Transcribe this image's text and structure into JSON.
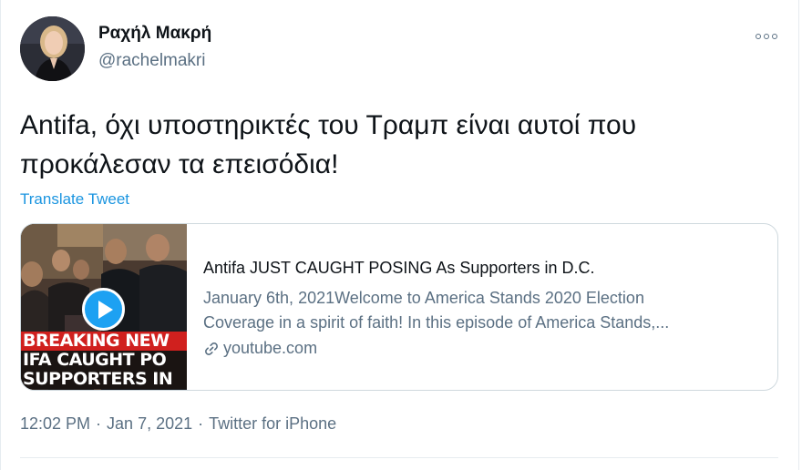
{
  "author": {
    "display_name": "Ραχήλ Μακρή",
    "handle": "@rachelmakri"
  },
  "tweet": {
    "text": "Antifa, όχι υποστηρικτές του Τραμπ είναι αυτοί που\nπροκάλεσαν τα επεισόδια!",
    "translate_label": "Translate Tweet"
  },
  "card": {
    "title": "Antifa JUST CAUGHT POSING As Supporters in D.C.",
    "description_line1": "January 6th, 2021Welcome to America Stands 2020 Election",
    "description_line2": "Coverage in a spirit of faith! In this episode of America Stands,...",
    "domain": "youtube.com",
    "thumbnail_overlay": {
      "line1": "BREAKING NEW",
      "line2": "IFA CAUGHT PO",
      "line3": "SUPPORTERS IN"
    },
    "play_color": "#1da1f2"
  },
  "meta": {
    "time": "12:02 PM",
    "separator": "·",
    "date": "Jan 7, 2021",
    "source": "Twitter for iPhone"
  },
  "icons": {
    "more": "more-icon",
    "link": "link-icon",
    "play": "play-icon"
  },
  "colors": {
    "link_blue": "#1b95e0",
    "secondary_text": "#5b7083",
    "breaking_red": "#d0201e"
  }
}
